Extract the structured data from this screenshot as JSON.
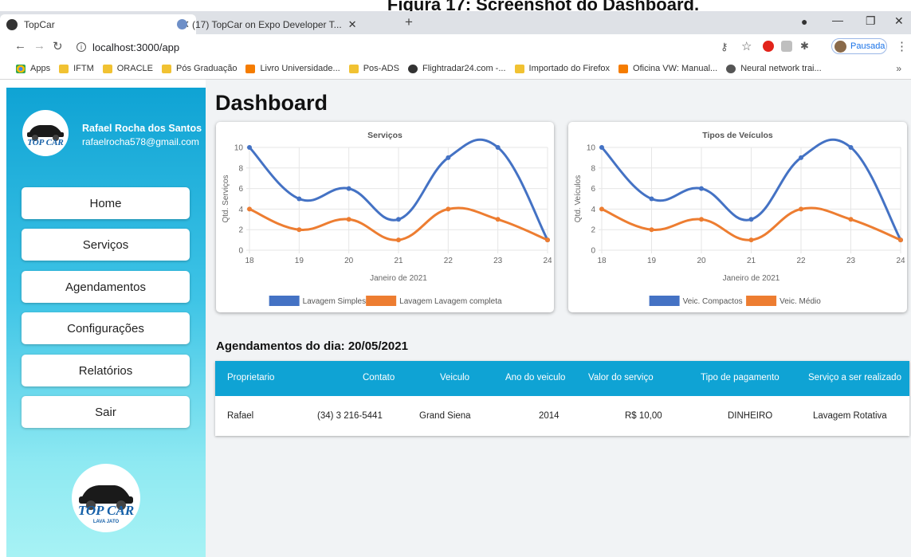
{
  "caption": "Figura 17: Screenshot do Dashboard.",
  "browser": {
    "tabs": [
      {
        "title": "TopCar",
        "active": true
      },
      {
        "title": "(17) TopCar on Expo Developer T...",
        "active": false
      }
    ],
    "url": "localhost:3000/app",
    "profile_label": "Pausada",
    "bookmarks": [
      "Apps",
      "IFTM",
      "ORACLE",
      "Pós Graduação",
      "Livro Universidade...",
      "Pos-ADS",
      "Flightradar24.com -...",
      "Importado do Firefox",
      "Oficina VW: Manual...",
      "Neural network trai..."
    ],
    "bookmarks_more": "»"
  },
  "sidebar": {
    "user_name": "Rafael Rocha dos Santos",
    "user_email": "rafaelrocha578@gmail.com",
    "logo_text": "TOP CAR",
    "logo_sub": "LAVA JATO",
    "nav": [
      "Home",
      "Serviços",
      "Agendamentos",
      "Configurações",
      "Relatórios",
      "Sair"
    ]
  },
  "main": {
    "title": "Dashboard",
    "schedule_title": "Agendamentos do dia: 20/05/2021",
    "table": {
      "headers": [
        "Proprietario",
        "Contato",
        "Veiculo",
        "Ano do veiculo",
        "Valor do serviço",
        "Tipo de pagamento",
        "Serviço a ser realizado"
      ],
      "rows": [
        [
          "Rafael",
          "(34) 3 216-5441",
          "Grand Siena",
          "2014",
          "R$ 10,00",
          "DINHEIRO",
          "Lavagem Rotativa"
        ]
      ]
    }
  },
  "chart_data": [
    {
      "type": "line",
      "title": "Serviços",
      "xlabel": "Janeiro de 2021",
      "ylabel": "Qtd. Serviços",
      "x": [
        18,
        19,
        20,
        21,
        22,
        23,
        24
      ],
      "ylim": [
        0,
        10
      ],
      "yticks": [
        0,
        2,
        4,
        6,
        8,
        10
      ],
      "grid": true,
      "legend": "bottom",
      "series": [
        {
          "name": "Lavagem Simples",
          "color": "#4472c4",
          "values": [
            10,
            5,
            6,
            3,
            9,
            10,
            1
          ]
        },
        {
          "name": "Lavagem Lavagem completa",
          "color": "#ed7d31",
          "values": [
            4,
            2,
            3,
            1,
            4,
            3,
            1
          ]
        }
      ]
    },
    {
      "type": "line",
      "title": "Tipos de Veículos",
      "xlabel": "Janeiro de 2021",
      "ylabel": "Qtd. Veículos",
      "x": [
        18,
        19,
        20,
        21,
        22,
        23,
        24
      ],
      "ylim": [
        0,
        10
      ],
      "yticks": [
        0,
        2,
        4,
        6,
        8,
        10
      ],
      "grid": true,
      "legend": "bottom",
      "series": [
        {
          "name": "Veic. Compactos",
          "color": "#4472c4",
          "values": [
            10,
            5,
            6,
            3,
            9,
            10,
            1
          ]
        },
        {
          "name": "Veic. Médio",
          "color": "#ed7d31",
          "values": [
            4,
            2,
            3,
            1,
            4,
            3,
            1
          ]
        }
      ]
    }
  ]
}
